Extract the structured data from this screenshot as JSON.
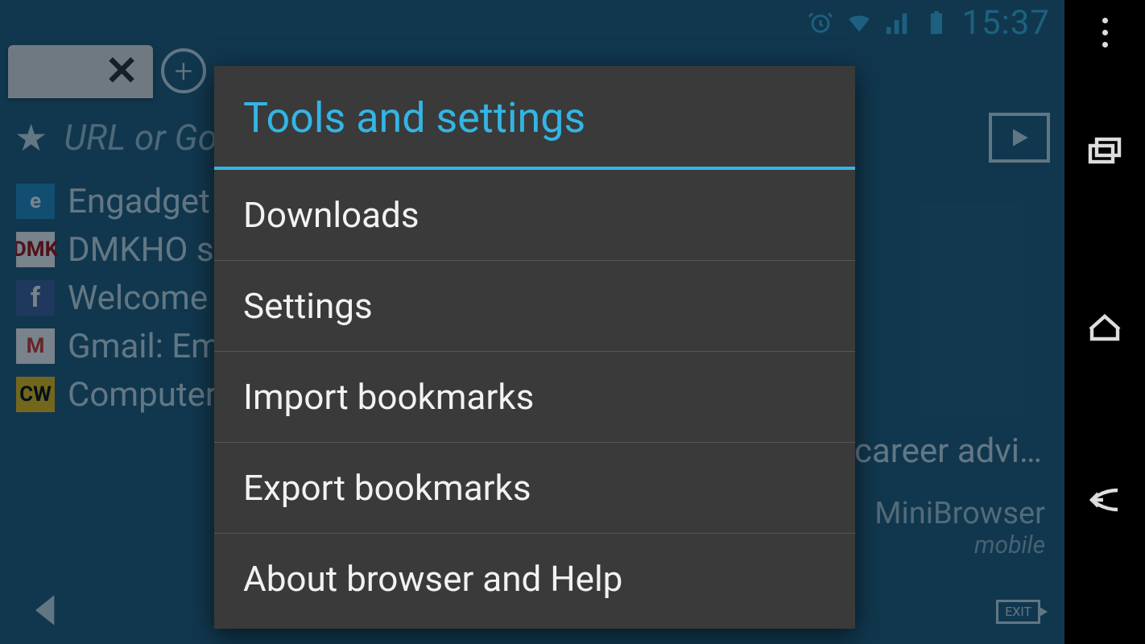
{
  "statusbar": {
    "time": "15:37"
  },
  "browser": {
    "url_placeholder": "URL or Go",
    "brand_name": "MiniBrowser",
    "brand_sub": "mobile",
    "exit_label": "EXIT",
    "truncated_text": ", career advi…",
    "bookmarks": [
      {
        "icon": "e",
        "label": "Engadget"
      },
      {
        "icon": "DMK",
        "label": "DMKHO s"
      },
      {
        "icon": "f",
        "label": "Welcome t"
      },
      {
        "icon": "M",
        "label": "Gmail: Em"
      },
      {
        "icon": "CW",
        "label": "Computer"
      }
    ]
  },
  "dialog": {
    "title": "Tools and settings",
    "items": [
      "Downloads",
      "Settings",
      "Import bookmarks",
      "Export bookmarks",
      "About browser and Help"
    ]
  }
}
